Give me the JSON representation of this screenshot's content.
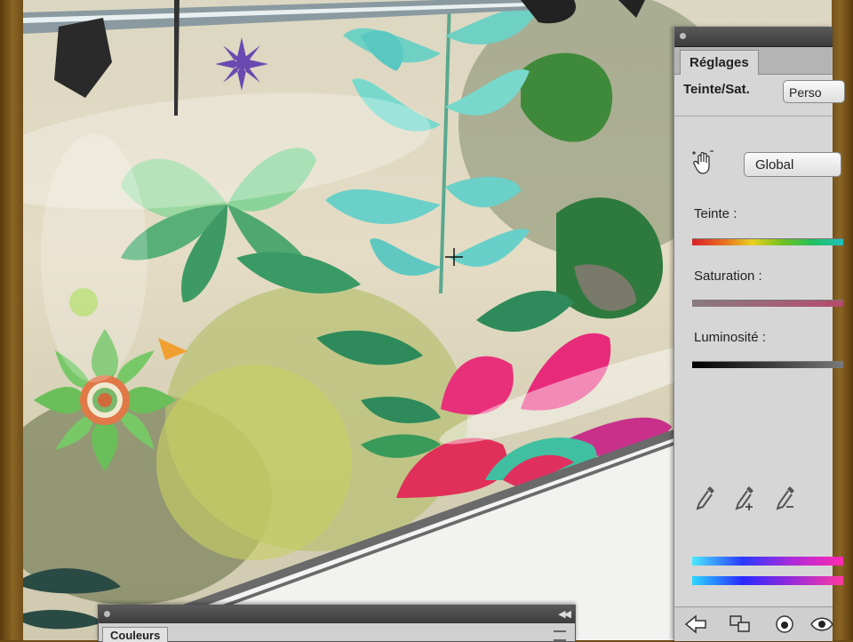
{
  "adjustments_panel": {
    "tab_label": "Réglages",
    "title": "Teinte/Sat.",
    "preset_value": "Perso",
    "channel_value": "Global",
    "labels": {
      "hue": "Teinte :",
      "saturation": "Saturation :",
      "lightness": "Luminosité :"
    },
    "icons": {
      "hand": "targeted-adjustment-hand-icon",
      "eyedropper_1": "eyedropper-icon",
      "eyedropper_2": "eyedropper-plus-icon",
      "eyedropper_3": "eyedropper-minus-icon",
      "footer_back": "back-arrow-icon",
      "footer_clip": "clip-to-layer-icon",
      "footer_visibility": "visibility-eye-icon",
      "footer_preview": "preview-eye-icon"
    }
  },
  "colors_panel": {
    "tab_label": "Couleurs"
  },
  "colors": {
    "panel_bg": "#d6d6d6",
    "titlebar": "#3c3c3c",
    "frame": "#6a4a16"
  }
}
